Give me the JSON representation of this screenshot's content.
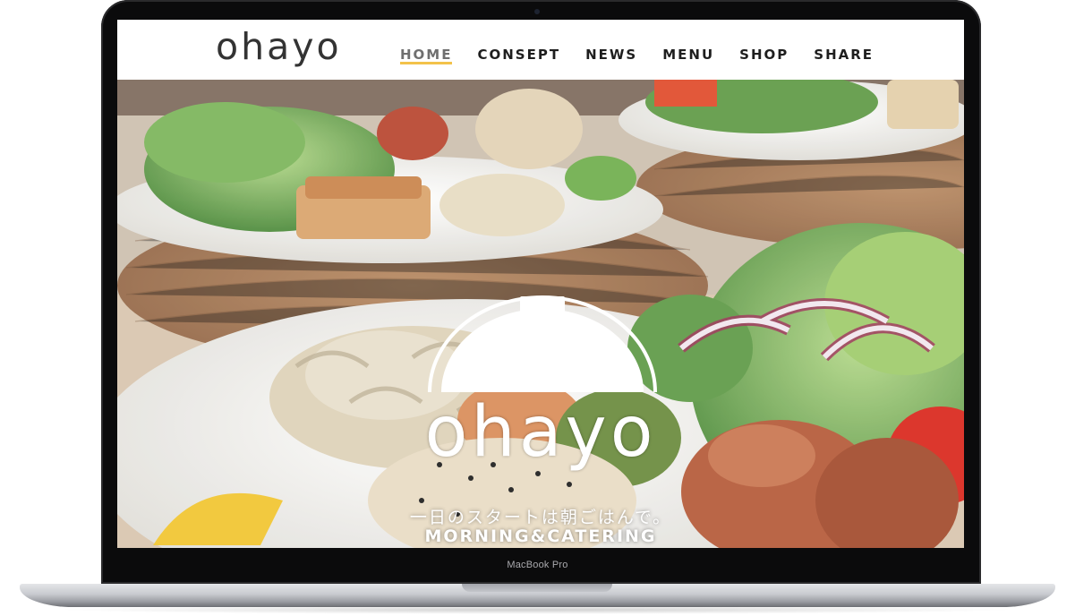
{
  "device": {
    "model_label": "MacBook Pro"
  },
  "site": {
    "logo_text": "ohayo",
    "nav": [
      {
        "label": "HOME",
        "active": true
      },
      {
        "label": "CONSEPT",
        "active": false
      },
      {
        "label": "NEWS",
        "active": false
      },
      {
        "label": "MENU",
        "active": false
      },
      {
        "label": "SHOP",
        "active": false
      },
      {
        "label": "SHARE",
        "active": false
      }
    ],
    "accent_color": "#f3c24a"
  },
  "hero": {
    "icon": "cloche-icon",
    "logo_text": "ohayo",
    "tagline": "一日のスタートは朝ごはんで。",
    "subtitle": "MORNING&CATERING"
  }
}
